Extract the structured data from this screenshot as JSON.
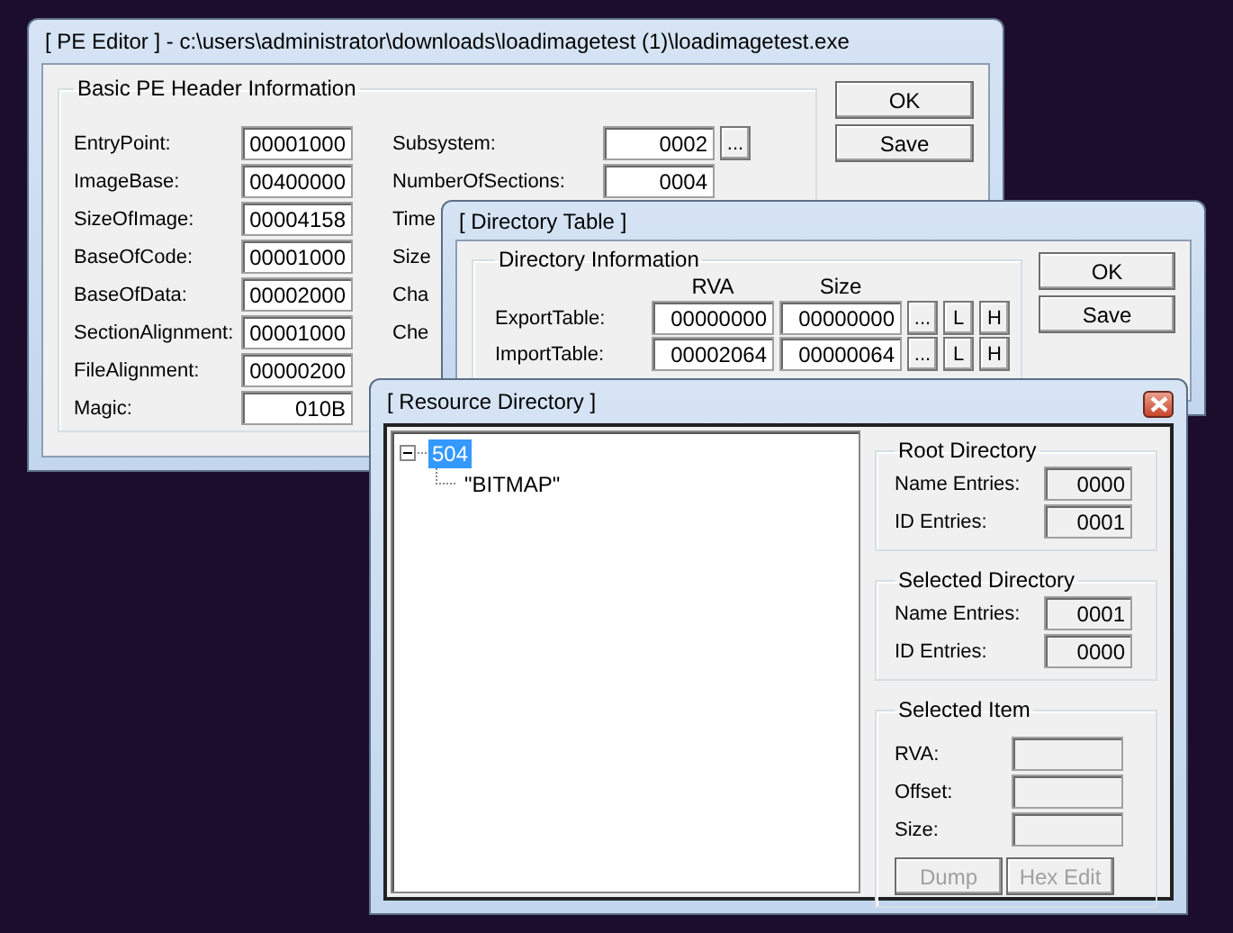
{
  "pe_editor": {
    "title": "[ PE Editor ] - c:\\users\\administrator\\downloads\\loadimagetest (1)\\loadimagetest.exe",
    "group_title": "Basic PE Header Information",
    "left_fields": [
      {
        "label": "EntryPoint:",
        "value": "00001000"
      },
      {
        "label": "ImageBase:",
        "value": "00400000"
      },
      {
        "label": "SizeOfImage:",
        "value": "00004158"
      },
      {
        "label": "BaseOfCode:",
        "value": "00001000"
      },
      {
        "label": "BaseOfData:",
        "value": "00002000"
      },
      {
        "label": "SectionAlignment:",
        "value": "00001000"
      },
      {
        "label": "FileAlignment:",
        "value": "00000200"
      },
      {
        "label": "Magic:",
        "value": "010B"
      }
    ],
    "right_fields": [
      {
        "label": "Subsystem:",
        "value": "0002",
        "button": "..."
      },
      {
        "label": "NumberOfSections:",
        "value": "0004"
      },
      {
        "label": "Time"
      },
      {
        "label": "Size"
      },
      {
        "label": "Cha"
      },
      {
        "label": "Che"
      }
    ],
    "buttons": [
      "OK",
      "Save"
    ]
  },
  "directory_table": {
    "title": "[ Directory Table ]",
    "group_title": "Directory Information",
    "columns": [
      "RVA",
      "Size"
    ],
    "rows": [
      {
        "label": "ExportTable:",
        "rva": "00000000",
        "size": "00000000",
        "buttons": [
          "...",
          "L",
          "H"
        ]
      },
      {
        "label": "ImportTable:",
        "rva": "00002064",
        "size": "00000064",
        "buttons": [
          "...",
          "L",
          "H"
        ]
      }
    ],
    "buttons": [
      "OK",
      "Save"
    ]
  },
  "resource_directory": {
    "title": "[ Resource Directory ]",
    "tree": [
      {
        "label": "504",
        "selected": true,
        "expanded": true,
        "children": [
          {
            "label": "\"BITMAP\"",
            "selected": false
          }
        ]
      }
    ],
    "root_directory": {
      "title": "Root Directory",
      "fields": [
        {
          "label": "Name Entries:",
          "value": "0000"
        },
        {
          "label": "ID Entries:",
          "value": "0001"
        }
      ]
    },
    "selected_directory": {
      "title": "Selected Directory",
      "fields": [
        {
          "label": "Name Entries:",
          "value": "0001"
        },
        {
          "label": "ID Entries:",
          "value": "0000"
        }
      ]
    },
    "selected_item": {
      "title": "Selected Item",
      "fields": [
        {
          "label": "RVA:"
        },
        {
          "label": "Offset:"
        },
        {
          "label": "Size:"
        }
      ],
      "buttons": [
        {
          "label": "Dump",
          "disabled": true
        },
        {
          "label": "Hex Edit",
          "disabled": true
        }
      ]
    }
  }
}
